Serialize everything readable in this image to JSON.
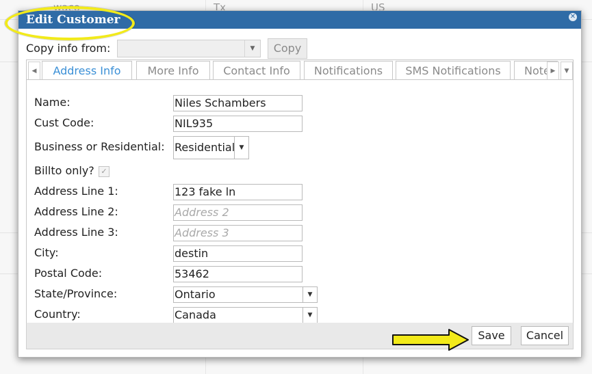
{
  "background": {
    "fragments": [
      "waco",
      "Tx",
      "US"
    ]
  },
  "dialog": {
    "title": "Edit Customer",
    "close_icon": "close-icon"
  },
  "copy_info": {
    "label": "Copy info from:",
    "selected": "",
    "button": "Copy"
  },
  "tabs": [
    {
      "label": "Address Info",
      "active": true
    },
    {
      "label": "More Info",
      "active": false
    },
    {
      "label": "Contact Info",
      "active": false
    },
    {
      "label": "Notifications",
      "active": false
    },
    {
      "label": "SMS Notifications",
      "active": false
    },
    {
      "label": "Note",
      "active": false
    }
  ],
  "form": {
    "name": {
      "label": "Name:",
      "value": "Niles Schambers"
    },
    "cust_code": {
      "label": "Cust Code:",
      "value": "NIL935"
    },
    "business": {
      "label": "Business or Residential:",
      "value": "Residential"
    },
    "billto": {
      "label": "Billto only?",
      "checked": true
    },
    "address1": {
      "label": "Address Line 1:",
      "value": "123 fake ln"
    },
    "address2": {
      "label": "Address Line 2:",
      "placeholder": "Address 2"
    },
    "address3": {
      "label": "Address Line 3:",
      "placeholder": "Address 3"
    },
    "city": {
      "label": "City:",
      "value": "destin"
    },
    "postal": {
      "label": "Postal Code:",
      "value": "53462"
    },
    "state": {
      "label": "State/Province:",
      "value": "Ontario"
    },
    "country": {
      "label": "Country:",
      "value": "Canada"
    }
  },
  "footer": {
    "save": "Save",
    "cancel": "Cancel"
  },
  "colors": {
    "titlebar": "#2f6ba6",
    "active_tab": "#3a8fd6",
    "highlight": "#f2ea1a"
  }
}
